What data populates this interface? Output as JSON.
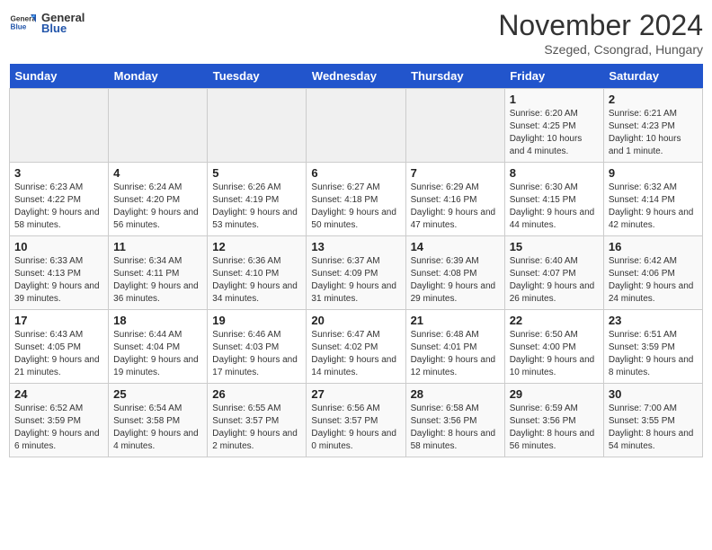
{
  "header": {
    "logo_general": "General",
    "logo_blue": "Blue",
    "month_title": "November 2024",
    "location": "Szeged, Csongrad, Hungary"
  },
  "weekdays": [
    "Sunday",
    "Monday",
    "Tuesday",
    "Wednesday",
    "Thursday",
    "Friday",
    "Saturday"
  ],
  "weeks": [
    [
      {
        "day": "",
        "info": ""
      },
      {
        "day": "",
        "info": ""
      },
      {
        "day": "",
        "info": ""
      },
      {
        "day": "",
        "info": ""
      },
      {
        "day": "",
        "info": ""
      },
      {
        "day": "1",
        "info": "Sunrise: 6:20 AM\nSunset: 4:25 PM\nDaylight: 10 hours and 4 minutes."
      },
      {
        "day": "2",
        "info": "Sunrise: 6:21 AM\nSunset: 4:23 PM\nDaylight: 10 hours and 1 minute."
      }
    ],
    [
      {
        "day": "3",
        "info": "Sunrise: 6:23 AM\nSunset: 4:22 PM\nDaylight: 9 hours and 58 minutes."
      },
      {
        "day": "4",
        "info": "Sunrise: 6:24 AM\nSunset: 4:20 PM\nDaylight: 9 hours and 56 minutes."
      },
      {
        "day": "5",
        "info": "Sunrise: 6:26 AM\nSunset: 4:19 PM\nDaylight: 9 hours and 53 minutes."
      },
      {
        "day": "6",
        "info": "Sunrise: 6:27 AM\nSunset: 4:18 PM\nDaylight: 9 hours and 50 minutes."
      },
      {
        "day": "7",
        "info": "Sunrise: 6:29 AM\nSunset: 4:16 PM\nDaylight: 9 hours and 47 minutes."
      },
      {
        "day": "8",
        "info": "Sunrise: 6:30 AM\nSunset: 4:15 PM\nDaylight: 9 hours and 44 minutes."
      },
      {
        "day": "9",
        "info": "Sunrise: 6:32 AM\nSunset: 4:14 PM\nDaylight: 9 hours and 42 minutes."
      }
    ],
    [
      {
        "day": "10",
        "info": "Sunrise: 6:33 AM\nSunset: 4:13 PM\nDaylight: 9 hours and 39 minutes."
      },
      {
        "day": "11",
        "info": "Sunrise: 6:34 AM\nSunset: 4:11 PM\nDaylight: 9 hours and 36 minutes."
      },
      {
        "day": "12",
        "info": "Sunrise: 6:36 AM\nSunset: 4:10 PM\nDaylight: 9 hours and 34 minutes."
      },
      {
        "day": "13",
        "info": "Sunrise: 6:37 AM\nSunset: 4:09 PM\nDaylight: 9 hours and 31 minutes."
      },
      {
        "day": "14",
        "info": "Sunrise: 6:39 AM\nSunset: 4:08 PM\nDaylight: 9 hours and 29 minutes."
      },
      {
        "day": "15",
        "info": "Sunrise: 6:40 AM\nSunset: 4:07 PM\nDaylight: 9 hours and 26 minutes."
      },
      {
        "day": "16",
        "info": "Sunrise: 6:42 AM\nSunset: 4:06 PM\nDaylight: 9 hours and 24 minutes."
      }
    ],
    [
      {
        "day": "17",
        "info": "Sunrise: 6:43 AM\nSunset: 4:05 PM\nDaylight: 9 hours and 21 minutes."
      },
      {
        "day": "18",
        "info": "Sunrise: 6:44 AM\nSunset: 4:04 PM\nDaylight: 9 hours and 19 minutes."
      },
      {
        "day": "19",
        "info": "Sunrise: 6:46 AM\nSunset: 4:03 PM\nDaylight: 9 hours and 17 minutes."
      },
      {
        "day": "20",
        "info": "Sunrise: 6:47 AM\nSunset: 4:02 PM\nDaylight: 9 hours and 14 minutes."
      },
      {
        "day": "21",
        "info": "Sunrise: 6:48 AM\nSunset: 4:01 PM\nDaylight: 9 hours and 12 minutes."
      },
      {
        "day": "22",
        "info": "Sunrise: 6:50 AM\nSunset: 4:00 PM\nDaylight: 9 hours and 10 minutes."
      },
      {
        "day": "23",
        "info": "Sunrise: 6:51 AM\nSunset: 3:59 PM\nDaylight: 9 hours and 8 minutes."
      }
    ],
    [
      {
        "day": "24",
        "info": "Sunrise: 6:52 AM\nSunset: 3:59 PM\nDaylight: 9 hours and 6 minutes."
      },
      {
        "day": "25",
        "info": "Sunrise: 6:54 AM\nSunset: 3:58 PM\nDaylight: 9 hours and 4 minutes."
      },
      {
        "day": "26",
        "info": "Sunrise: 6:55 AM\nSunset: 3:57 PM\nDaylight: 9 hours and 2 minutes."
      },
      {
        "day": "27",
        "info": "Sunrise: 6:56 AM\nSunset: 3:57 PM\nDaylight: 9 hours and 0 minutes."
      },
      {
        "day": "28",
        "info": "Sunrise: 6:58 AM\nSunset: 3:56 PM\nDaylight: 8 hours and 58 minutes."
      },
      {
        "day": "29",
        "info": "Sunrise: 6:59 AM\nSunset: 3:56 PM\nDaylight: 8 hours and 56 minutes."
      },
      {
        "day": "30",
        "info": "Sunrise: 7:00 AM\nSunset: 3:55 PM\nDaylight: 8 hours and 54 minutes."
      }
    ]
  ]
}
